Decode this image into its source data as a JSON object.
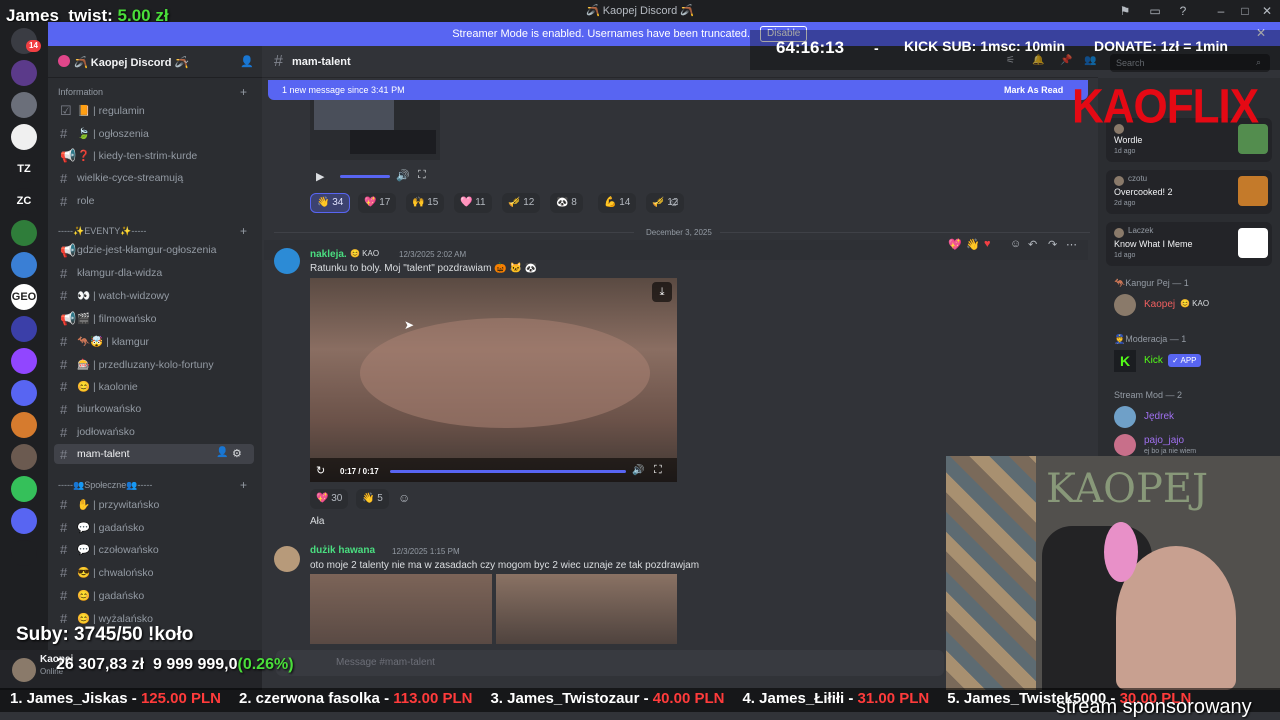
{
  "window": {
    "title": "🪃 Kaopej Discord 🪃",
    "overlay_donor_name": "James_twist:",
    "overlay_donor_amount": "5.00 zł"
  },
  "banner": {
    "text": "Streamer Mode is enabled. Usernames have been truncated.",
    "disable_label": "Disable"
  },
  "servers": [
    {
      "label": "",
      "color": "#3a3c43"
    },
    {
      "label": "",
      "color": "#5b3a8a"
    },
    {
      "label": "",
      "color": "#6b6f7a"
    },
    {
      "label": "",
      "color": "#f0f0f0"
    },
    {
      "label": "TZ",
      "color": "#1e1f22"
    },
    {
      "label": "ZC",
      "color": "#1e1f22"
    },
    {
      "label": "",
      "color": "#2f7d3a"
    },
    {
      "label": "",
      "color": "#3a7fd5"
    },
    {
      "label": "GEO",
      "color": "#ffffff"
    },
    {
      "label": "",
      "color": "#3b3fa8"
    },
    {
      "label": "",
      "color": "#9146ff"
    },
    {
      "label": "",
      "color": "#5865f2"
    },
    {
      "label": "",
      "color": "#d67b2e"
    },
    {
      "label": "",
      "color": "#6b5a50"
    },
    {
      "label": "",
      "color": "#35c05a"
    },
    {
      "label": "",
      "color": "#5865f2"
    },
    {
      "label": "",
      "color": "#1e1f22"
    }
  ],
  "server_badge": "14",
  "guild": {
    "name": "🪃 Kaopej Discord 🪃"
  },
  "categories": {
    "information": "Information",
    "eventy": "-----✨EVENTY✨-----",
    "spoleczne": "-----👥Społeczne👥-----"
  },
  "channels_info": [
    {
      "icon": "☑",
      "label": "📙 | regulamin"
    },
    {
      "icon": "#",
      "label": "🍃 | ogłoszenia"
    },
    {
      "icon": "📢",
      "label": "❓ | kiedy-ten-strim-kurde"
    },
    {
      "icon": "#",
      "label": "wielkie-cyce-streamują"
    },
    {
      "icon": "#",
      "label": "role"
    }
  ],
  "channels_eventy": [
    {
      "icon": "📢",
      "label": "gdzie-jest-kłamgur-ogłoszenia"
    },
    {
      "icon": "#",
      "label": "kłamgur-dla-widza"
    },
    {
      "icon": "#",
      "label": "👀 | watch-widzowy"
    },
    {
      "icon": "📢",
      "label": "🎬 | filmowańsko"
    },
    {
      "icon": "#",
      "label": "🦘🤯 | kłamgur"
    },
    {
      "icon": "#",
      "label": "🎰 | przedluzany-kolo-fortuny"
    },
    {
      "icon": "#",
      "label": "😊 | kaolonie"
    },
    {
      "icon": "#",
      "label": "biurkowańsko"
    },
    {
      "icon": "#",
      "label": "jodłowańsko"
    },
    {
      "icon": "#",
      "label": "mam-talent"
    }
  ],
  "channels_social": [
    {
      "icon": "#",
      "label": "✋ | przywitańsko"
    },
    {
      "icon": "#",
      "label": "💬 | gadańsko"
    },
    {
      "icon": "#",
      "label": "💬 | czołowańsko"
    },
    {
      "icon": "#",
      "label": "😎 | chwalońsko"
    },
    {
      "icon": "#",
      "label": "😊 | gadańsko"
    },
    {
      "icon": "#",
      "label": "😊 | wyżalańsko"
    }
  ],
  "chat": {
    "channel": "mam-talent",
    "new_messages": "1 new message since 3:41 PM",
    "mark_read": "Mark As Read",
    "search_placeholder": "Search",
    "input_placeholder": "Message #mam-talent",
    "date_divider": "December 3, 2025"
  },
  "reactions_top": [
    {
      "emoji": "👋",
      "count": "34",
      "me": true
    },
    {
      "emoji": "💖",
      "count": "17",
      "me": false
    },
    {
      "emoji": "🙌",
      "count": "15",
      "me": false
    },
    {
      "emoji": "🩷",
      "count": "11",
      "me": false
    },
    {
      "emoji": "🎺",
      "count": "12",
      "me": false
    },
    {
      "emoji": "🐼",
      "count": "8",
      "me": false
    },
    {
      "emoji": "💪",
      "count": "14",
      "me": false
    },
    {
      "emoji": "🎺",
      "count": "12",
      "me": false
    }
  ],
  "msg1": {
    "author": "nakleja.",
    "badge": "😊 KAO",
    "time": "12/3/2025 2:02 AM",
    "text": "Ratunku to boly. Moj \"talent\" pozdrawiam 🎃 🐱 🐼",
    "video_time": "0:17 / 0:17",
    "reactions": [
      {
        "emoji": "💖",
        "count": "30"
      },
      {
        "emoji": "👋",
        "count": "5"
      }
    ],
    "followup": "Ała"
  },
  "msg2": {
    "author": "dużik hawana",
    "time": "12/3/2025 1:15 PM",
    "text": "oto moje 2 talenty nie ma w zasadach czy mogom byc 2 wiec uznaje ze tak pozdrawjam"
  },
  "activities": [
    {
      "user": "",
      "game": "Wordle",
      "when": "1d ago",
      "color": "#538d4e"
    },
    {
      "user": "czotu",
      "game": "Overcooked! 2",
      "when": "2d ago",
      "color": "#c47a2a"
    },
    {
      "user": "Laczek",
      "game": "Know What I Meme",
      "when": "1d ago",
      "color": "#ffffff"
    }
  ],
  "members": {
    "cat1": "🦘Kangur Pej — 1",
    "cat1_name": "Kaopej",
    "cat1_badge": "😊 KAO",
    "cat2": "👮Moderacja — 1",
    "cat2_name": "Kick",
    "cat2_app": "✓ APP",
    "cat3": "Stream Mod — 2",
    "cat3_names": [
      "Jędrek",
      "pajo_jajo"
    ],
    "cat3_status": "ej bo ja nie wiem"
  },
  "overlay": {
    "timer": "64:16:13",
    "dash": "-",
    "kick_sub": "KICK SUB: 1msc: 10min",
    "donate": "DONATE: 1zł = 1min",
    "kaoflix": "KAOFLIX",
    "sub_goal": "Suby: 3745/50",
    "kolo": "!koło",
    "money_current": "26 307,83 zł",
    "money_goal": "9 999 999,0",
    "money_pct": "(0.26%)",
    "sponsored": "stream sponsorowany",
    "ticker": [
      {
        "rank": "1. James_Jiskas -",
        "value": "125.00 PLN"
      },
      {
        "rank": "2. czerwona fasolka -",
        "value": "113.00 PLN"
      },
      {
        "rank": "3. James_Twistozaur -",
        "value": "40.00 PLN"
      },
      {
        "rank": "4. James_Łiłiłi -",
        "value": "31.00 PLN"
      },
      {
        "rank": "5. James_Twistek5000 -",
        "value": "30.00 PLN"
      }
    ],
    "webcam_wall_text": "KAOPEJ"
  },
  "user": {
    "name": "Kaopej",
    "status": "Online"
  }
}
